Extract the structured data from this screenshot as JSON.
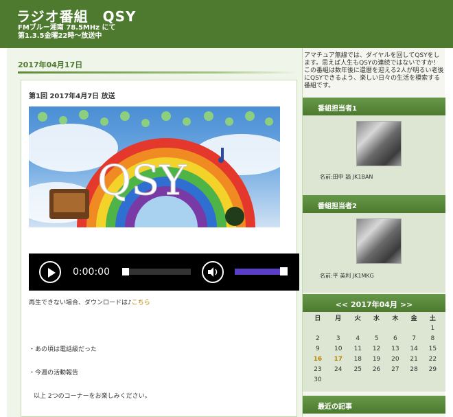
{
  "header": {
    "title": "ラジオ番組　QSY",
    "subtitle_line1": "FMブルー湘南 78.5MHz にて",
    "subtitle_line2": "第1.3.5金曜22時〜放送中"
  },
  "entry": {
    "date": "2017年04月17日",
    "title": "第1回 2017年4月7日 放送",
    "banner_text": "QSY",
    "player": {
      "time": "0:00:00",
      "volume_fraction": 0.9,
      "progress_fraction": 0
    },
    "download_text": "再生できない場合、ダウンロードは♪",
    "download_link": "こちら",
    "bullet1": "・あの頃は電話級だった",
    "bullet2": "・今週の活動報告",
    "closing": "以上 2つのコーナーをお楽しみください。"
  },
  "sidebar": {
    "intro": "アマチュア無線では、ダイヤルを回してQSYをします。思えば人生もQSYの連続ではないですか！この番組は数年後に還暦を迎える2人が明るい老後にQSYできるよう、楽しい日々の生活を模索する番組です。",
    "member1": {
      "heading": "番組担当者1",
      "name": "名前:田中 諭 JK1BAN"
    },
    "member2": {
      "heading": "番組担当者2",
      "name": "名前:平 英利 JK1MKG"
    },
    "calendar": {
      "prev": "<<",
      "month": "2017年04月",
      "next": ">>",
      "weekdays": [
        "日",
        "月",
        "火",
        "水",
        "木",
        "金",
        "土"
      ],
      "weeks": [
        [
          "",
          "",
          "",
          "",
          "",
          "",
          "1"
        ],
        [
          "2",
          "3",
          "4",
          "5",
          "6",
          "7",
          "8"
        ],
        [
          "9",
          "10",
          "11",
          "12",
          "13",
          "14",
          "15"
        ],
        [
          "16",
          "17",
          "18",
          "19",
          "20",
          "21",
          "22"
        ],
        [
          "23",
          "24",
          "25",
          "26",
          "27",
          "28",
          "29"
        ],
        [
          "30",
          "",
          "",
          "",
          "",
          "",
          ""
        ]
      ],
      "highlighted": [
        "16",
        "17"
      ]
    },
    "recent_heading": "最近の記事"
  },
  "colors": {
    "header": "#4e7a2f",
    "link": "#b8860b",
    "volume": "#5b3ec8"
  }
}
